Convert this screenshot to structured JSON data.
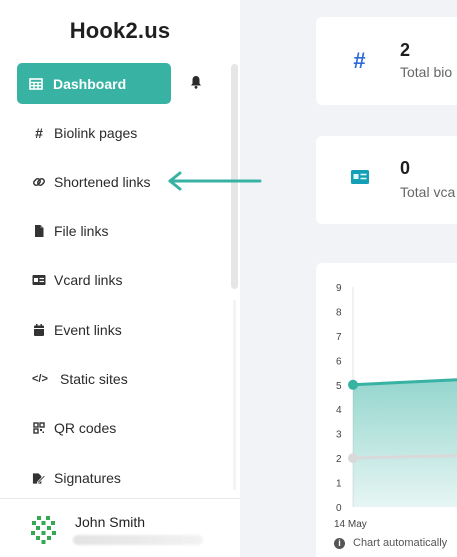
{
  "sidebar": {
    "brand": "Hook2.us",
    "active_item": {
      "label": "Dashboard",
      "icon": "table-icon"
    },
    "items": [
      {
        "label": "Biolink pages",
        "icon": "hash-icon"
      },
      {
        "label": "Shortened links",
        "icon": "link-icon"
      },
      {
        "label": "File links",
        "icon": "file-icon"
      },
      {
        "label": "Vcard links",
        "icon": "id-card-icon"
      },
      {
        "label": "Event links",
        "icon": "calendar-icon"
      },
      {
        "label": "Static sites",
        "icon": "code-icon"
      },
      {
        "label": "QR codes",
        "icon": "qrcode-icon"
      },
      {
        "label": "Signatures",
        "icon": "signature-icon"
      }
    ],
    "user": {
      "name": "John Smith"
    }
  },
  "stats": [
    {
      "value": "2",
      "label": "Total bio",
      "icon": "hash-icon",
      "icon_bg": "#e8f1fd",
      "icon_color": "#2f6bd6"
    },
    {
      "value": "0",
      "label": "Total vca",
      "icon": "id-card-icon",
      "icon_bg": "#e0f7fa",
      "icon_color": "#139fb5"
    }
  ],
  "chart_data": {
    "type": "line",
    "x": [
      "14 May",
      ""
    ],
    "ylim": [
      0,
      9
    ],
    "yticks": [
      "0",
      "1",
      "2",
      "3",
      "4",
      "5",
      "6",
      "7",
      "8",
      "9"
    ],
    "series": [
      {
        "values": [
          5,
          5.4
        ],
        "color": "#38b2a3",
        "fill": true
      },
      {
        "values": [
          2,
          2.2
        ],
        "color": "#d9d9d9",
        "fill": false
      }
    ]
  },
  "chart_footnote": "Chart automatically",
  "colors": {
    "accent": "#38b2a3",
    "background": "#f1f3f7"
  }
}
